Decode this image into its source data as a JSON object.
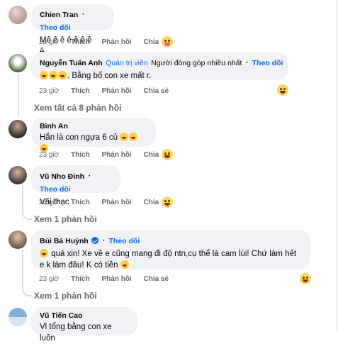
{
  "comments": [
    {
      "name": "Chien Tran",
      "follow": "Theo dõi",
      "text": "Mê ê ê ê ê ê ê ê....",
      "time": "23 giờ",
      "like": "Thích",
      "reply": "Phản hồi",
      "share": "Chia sẻ",
      "reaction": "tongue-out-icon"
    },
    {
      "name": "Nguyễn Tuấn Anh",
      "admin_badge": "Quản trị viên",
      "contrib_badge": "Người đóng góp nhiều nhất",
      "follow": "Theo dõi",
      "text": ". Bằng bố con xe mất r.",
      "time": "23 giờ",
      "like": "Thích",
      "reply": "Phản hồi",
      "share": "Chia sẻ",
      "reaction": "laughing-face-icon"
    }
  ],
  "view_all_replies": "Xem tất cả 8 phản hồi",
  "replies": [
    {
      "name": "Bình An",
      "text": "Hắn là con ngựa 6 củ",
      "time": "23 giờ",
      "like": "Thích",
      "reply": "Phản hồi",
      "share": "Chia sẻ"
    },
    {
      "name": "Vũ Nho Đỉnh",
      "follow": "Theo dõi",
      "text": "Vãi thạc",
      "time": "23 giờ",
      "like": "Thích",
      "reply": "Phản hồi",
      "share": "Chia sẻ"
    },
    {
      "name": "Bùi Bá Huỳnh",
      "follow": "Theo dõi",
      "text_line1": "quá xịn! Xe về e cũng mang đi độ ntn,cụ thể là cam lùi! Chứ làm hết",
      "text_line2": "e k làm đâu! K có tiền",
      "time": "23 giờ",
      "like": "Thích",
      "reply": "Phản hồi",
      "share": "Chia sẻ"
    },
    {
      "name": "Vũ Tiến Cao",
      "text": "Vl tổng bằng con xe luôn"
    }
  ],
  "view_one_reply": "Xem 1 phản hồi",
  "view_one_reply_2": "Xem 1 phản hồi"
}
